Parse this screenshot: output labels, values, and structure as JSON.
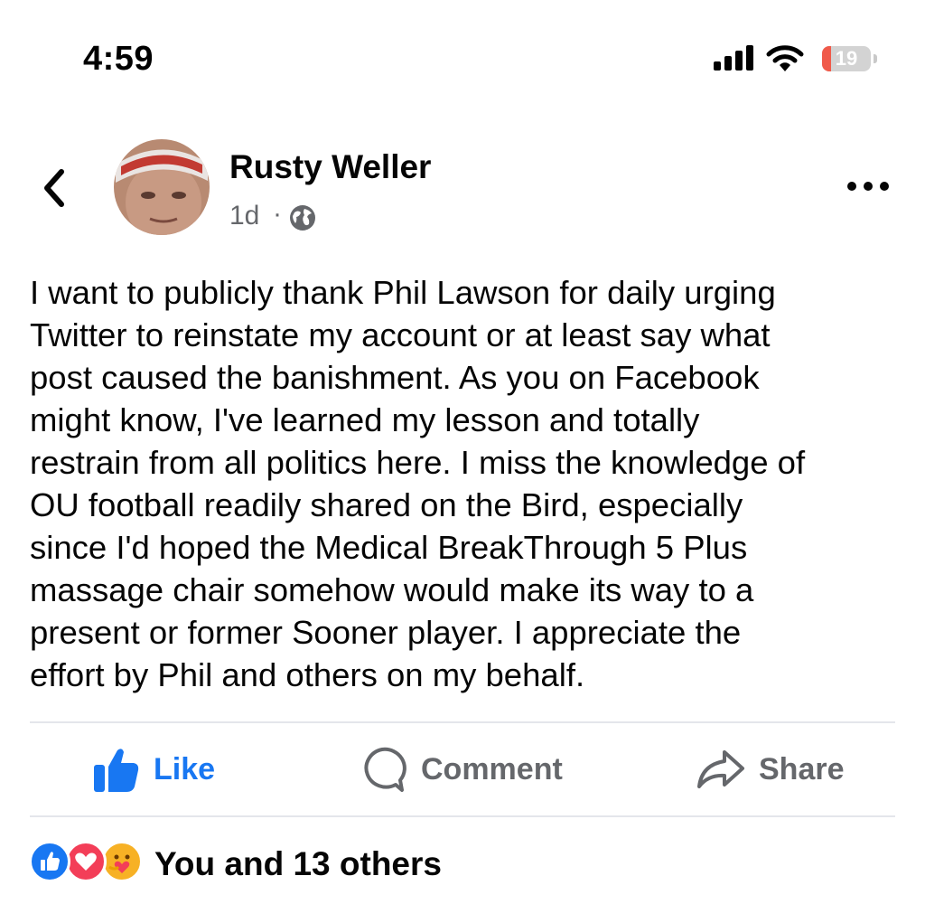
{
  "status_bar": {
    "time": "4:59",
    "battery": "19",
    "battery_level_percent": 19,
    "icons": [
      "cellular-signal-icon",
      "wifi-icon",
      "battery-icon"
    ]
  },
  "post": {
    "author": "Rusty Weller",
    "time": "1d",
    "separator": "·",
    "privacy_icon": "globe-icon",
    "body": "I want to publicly thank Phil Lawson for daily urging\nTwitter to reinstate my account or at least say what\npost caused the banishment. As you on Facebook\nmight know, I've learned my lesson and totally\nrestrain from all politics here. I miss the knowledge of\nOU football readily shared on the Bird, especially\nsince I'd hoped the Medical BreakThrough 5 Plus\nmassage chair somehow would make its way to a\npresent or former Sooner player. I appreciate the\neffort by Phil and others on my behalf."
  },
  "header": {
    "back_icon": "chevron-left-icon",
    "more_icon": "more-dots-icon"
  },
  "actions": {
    "like": "Like",
    "comment": "Comment",
    "share": "Share"
  },
  "reactions": {
    "types": [
      "like",
      "love",
      "care"
    ],
    "summary": "You and 13 others"
  },
  "colors": {
    "facebook_blue": "#1877f2",
    "secondary_text": "#65676b",
    "divider": "#e4e6eb",
    "love_red": "#f33e58",
    "care_yellow": "#f7b125",
    "battery_red": "#f05a4a"
  }
}
